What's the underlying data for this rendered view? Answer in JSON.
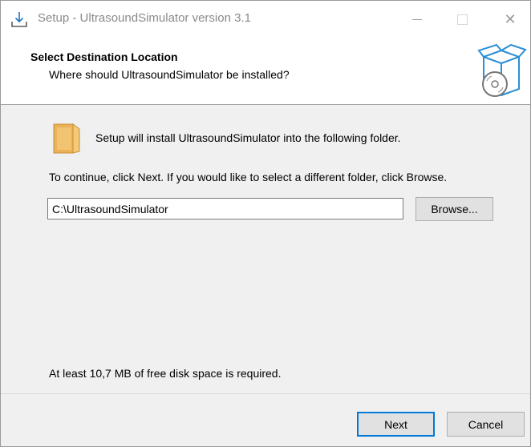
{
  "window": {
    "title": "Setup - UltrasoundSimulator version 3.1",
    "minimize_glyph": "",
    "close_glyph": "✕"
  },
  "header": {
    "title": "Select Destination Location",
    "subtitle": "Where should UltrasoundSimulator be installed?"
  },
  "body": {
    "info_text": "Setup will install UltrasoundSimulator into the following folder.",
    "instruction_text": "To continue, click Next. If you would like to select a different folder, click Browse.",
    "path_value": "C:\\UltrasoundSimulator",
    "browse_label": "Browse...",
    "disk_space_text": "At least 10,7 MB of free disk space is required."
  },
  "footer": {
    "next_label": "Next",
    "cancel_label": "Cancel"
  },
  "icons": {
    "title": "setup-install-icon",
    "header": "wizard-box-disc-icon",
    "folder": "folder-icon"
  }
}
